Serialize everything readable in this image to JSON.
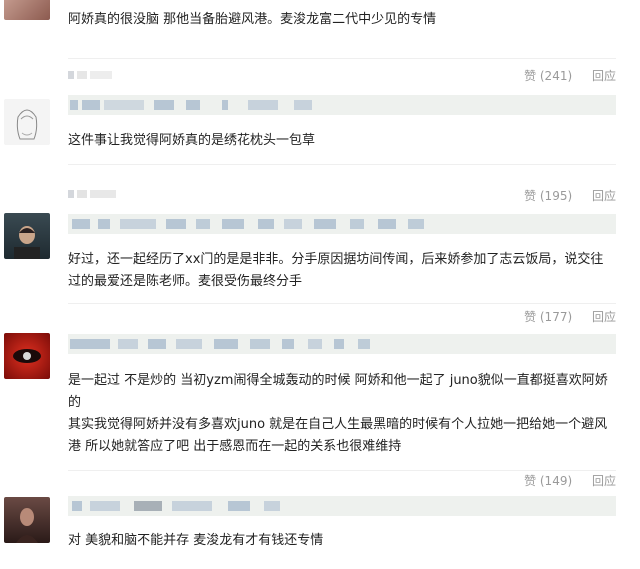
{
  "comments": [
    {
      "text": "阿娇真的很没脑 那他当备胎避风港。麦浚龙富二代中少见的专情"
    },
    {
      "like_label": "赞 (241)",
      "reply_label": "回应",
      "text": "这件事让我觉得阿娇真的是绣花枕头一包草"
    },
    {
      "like_label": "赞 (195)",
      "reply_label": "回应",
      "text": "好过，还一起经历了xx门的是是非非。分手原因据坊间传闻，后来娇参加了志云饭局，说交往过的最爱还是陈老师。麦很受伤最终分手"
    },
    {
      "like_label": "赞 (177)",
      "reply_label": "回应",
      "text_lines": [
        "是一起过 不是炒的 当初yzm闹得全城轰动的时候 阿娇和他一起了 juno貌似一直都挺喜欢阿娇的",
        "其实我觉得阿娇并没有多喜欢juno 就是在自己人生最黑暗的时候有个人拉她一把给她一个避风港 所以她就答应了吧 出于感恩而在一起的关系也很难维持"
      ]
    },
    {
      "like_label": "赞 (149)",
      "reply_label": "回应",
      "text": "对 美貌和脑不能并存 麦浚龙有才有钱还专情"
    }
  ],
  "colors": {
    "action_text": "#9a9a9a",
    "quote_bar": "#eef1ee",
    "body_text": "#222222"
  }
}
